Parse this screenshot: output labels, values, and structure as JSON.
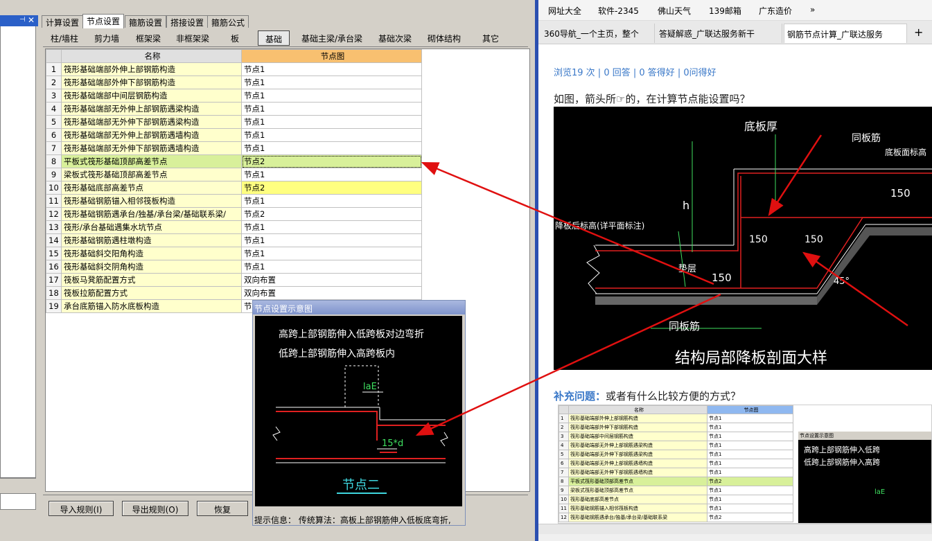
{
  "left_panel": {
    "pin_icon": "⊣",
    "close_icon": "✕"
  },
  "top_tabs": [
    "计算设置",
    "节点设置",
    "箍筋设置",
    "搭接设置",
    "箍筋公式"
  ],
  "sub_tabs": [
    "柱/墙柱",
    "剪力墙",
    "框架梁",
    "非框架梁",
    "板",
    "基础",
    "基础主梁/承台梁",
    "基础次梁",
    "砌体结构",
    "其它"
  ],
  "grid": {
    "headers": [
      "名称",
      "节点图"
    ],
    "rows": [
      {
        "n": "1",
        "name": "筏形基础端部外伸上部钢筋构造",
        "node": "节点1"
      },
      {
        "n": "2",
        "name": "筏形基础端部外伸下部钢筋构造",
        "node": "节点1"
      },
      {
        "n": "3",
        "name": "筏形基础端部中间层钢筋构造",
        "node": "节点1"
      },
      {
        "n": "4",
        "name": "筏形基础端部无外伸上部钢筋遇梁构造",
        "node": "节点1"
      },
      {
        "n": "5",
        "name": "筏形基础端部无外伸下部钢筋遇梁构造",
        "node": "节点1"
      },
      {
        "n": "6",
        "name": "筏形基础端部无外伸上部钢筋遇墙构造",
        "node": "节点1"
      },
      {
        "n": "7",
        "name": "筏形基础端部无外伸下部钢筋遇墙构造",
        "node": "节点1"
      },
      {
        "n": "8",
        "name": "平板式筏形基础顶部高差节点",
        "node": "节点2"
      },
      {
        "n": "9",
        "name": "梁板式筏形基础顶部高差节点",
        "node": "节点1"
      },
      {
        "n": "10",
        "name": "筏形基础底部高差节点",
        "node": "节点2"
      },
      {
        "n": "11",
        "name": "筏形基础钢筋锚入相邻筏板构造",
        "node": "节点1"
      },
      {
        "n": "12",
        "name": "筏形基础钢筋遇承台/独基/承台梁/基础联系梁/",
        "node": "节点2"
      },
      {
        "n": "13",
        "name": "筏形/承台基础遇集水坑节点",
        "node": "节点1"
      },
      {
        "n": "14",
        "name": "筏形基础钢筋遇柱墩构造",
        "node": "节点1"
      },
      {
        "n": "15",
        "name": "筏形基础斜交阳角构造",
        "node": "节点1"
      },
      {
        "n": "16",
        "name": "筏形基础斜交阴角构造",
        "node": "节点1"
      },
      {
        "n": "17",
        "name": "筏板马凳筋配置方式",
        "node": "双向布置"
      },
      {
        "n": "18",
        "name": "筏板拉筋配置方式",
        "node": "双向布置"
      },
      {
        "n": "19",
        "name": "承台底筋锚入防水底板构造",
        "node": "节"
      }
    ]
  },
  "buttons": {
    "import": "导入规则(I)",
    "export": "导出规则(O)",
    "restore": "恢复"
  },
  "popup": {
    "title": "节点设置示意图",
    "line1": "高跨上部钢筋伸入低跨板对边弯折",
    "line2": "低跨上部钢筋伸入高跨板内",
    "lae": "laE",
    "dim": "15*d",
    "caption": "节点二",
    "hint": "提示信息：  传统算法：高板上部钢筋伸入低板底弯折,"
  },
  "browser": {
    "bookmarks": [
      "网址大全",
      "软件-2345",
      "佛山天气",
      "139邮箱",
      "广东造价"
    ],
    "more": "»",
    "tabs": [
      "360导航_一个主页，整个",
      "答疑解惑_广联达服务新干",
      "钢筋节点计算_广联达服务"
    ],
    "stats": "浏览19 次 | 0 回答 | 0 答得好 | 0问得好",
    "question": "如图，箭头所☞的，在计算节点能设置吗？",
    "supp_label": "补充问题：",
    "supp_text": "或者有什么比较方便的方式？",
    "cad": {
      "label_top": "底板厚",
      "label_tong": "同板筋",
      "label_dbm": "底板面标高",
      "label_h": "h",
      "label_left": "降板后标高(详平面标注)",
      "d150a": "150",
      "d150b": "150",
      "d150c": "150",
      "d150d": "150",
      "label_tong2": "同板筋",
      "label_45": "45°",
      "label_pad": "垫层",
      "title": "结构局部降板剖面大样"
    },
    "mini": {
      "headers": [
        "名称",
        "节点图"
      ],
      "rows": [
        {
          "n": "1",
          "name": "筏形基础端部外伸上部钢筋构造",
          "node": "节点1"
        },
        {
          "n": "2",
          "name": "筏形基础端部外伸下部钢筋构造",
          "node": "节点1"
        },
        {
          "n": "3",
          "name": "筏形基础端部中间层钢筋构造",
          "node": "节点1"
        },
        {
          "n": "4",
          "name": "筏形基础端部无外伸上部钢筋遇梁构造",
          "node": "节点1"
        },
        {
          "n": "5",
          "name": "筏形基础端部无外伸下部钢筋遇梁构造",
          "node": "节点1"
        },
        {
          "n": "6",
          "name": "筏形基础端部无外伸上部钢筋遇墙构造",
          "node": "节点1"
        },
        {
          "n": "7",
          "name": "筏形基础端部无外伸下部钢筋遇墙构造",
          "node": "节点1"
        },
        {
          "n": "8",
          "name": "平板式筏形基础顶部高差节点",
          "node": "节点2"
        },
        {
          "n": "9",
          "name": "梁板式筏形基础顶部高差节点",
          "node": "节点1"
        },
        {
          "n": "10",
          "name": "筏形基础底部高差节点",
          "node": "节点1"
        },
        {
          "n": "11",
          "name": "筏形基础钢筋锚入相邻筏板构造",
          "node": "节点1"
        },
        {
          "n": "12",
          "name": "筏形基础钢筋遇承台/独基/承台梁/基础联系梁",
          "node": "节点2"
        }
      ],
      "popup_title": "节点设置示意图",
      "line1": "高跨上部钢筋伸入低跨",
      "line2": "低跨上部钢筋伸入高跨",
      "lae": "laE"
    }
  }
}
